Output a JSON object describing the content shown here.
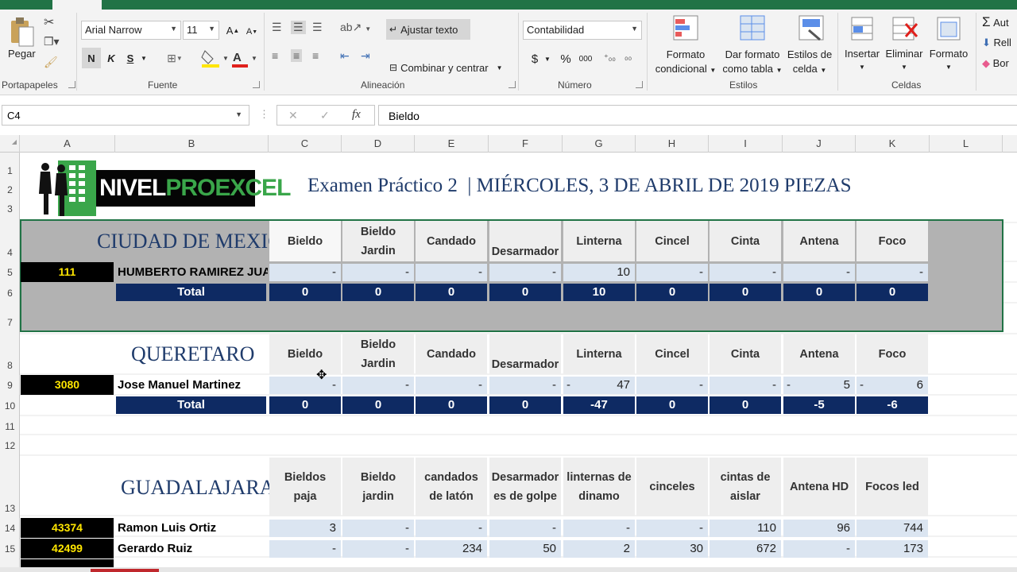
{
  "ribbon": {
    "portapapeles": {
      "pegar": "Pegar",
      "label": "Portapapeles"
    },
    "fuente": {
      "font_name": "Arial Narrow",
      "font_size": "11",
      "bold": "N",
      "italic": "K",
      "underline": "S",
      "label": "Fuente"
    },
    "alineacion": {
      "wrap": "Ajustar texto",
      "merge": "Combinar y centrar",
      "label": "Alineación"
    },
    "numero": {
      "format": "Contabilidad",
      "currency": "$",
      "percent": "%",
      "thousands": "000",
      "label": "Número"
    },
    "estilos": {
      "cond_line1": "Formato",
      "cond_line2": "condicional",
      "table_line1": "Dar formato",
      "table_line2": "como tabla",
      "cell_line1": "Estilos de",
      "cell_line2": "celda",
      "label": "Estilos"
    },
    "celdas": {
      "insertar": "Insertar",
      "eliminar": "Eliminar",
      "formato": "Formato",
      "label": "Celdas"
    },
    "edicion": {
      "auto": "Aut",
      "rell": "Rell",
      "borr": "Bor"
    }
  },
  "formula_bar": {
    "name_box": "C4",
    "cancel": "✕",
    "enter": "✓",
    "fx": "fx",
    "content": "Bieldo"
  },
  "columns": [
    "A",
    "B",
    "C",
    "D",
    "E",
    "F",
    "G",
    "H",
    "I",
    "J",
    "K",
    "L"
  ],
  "rows": [
    "1",
    "2",
    "3",
    "4",
    "5",
    "6",
    "7",
    "8",
    "9",
    "10",
    "11",
    "12",
    "13",
    "14",
    "15"
  ],
  "logo": {
    "text1": "NIVEL",
    "text2": "PRO",
    "text3": "EXCEL"
  },
  "title": "Examen Práctico 2  | MIÉRCOLES, 3 DE ABRIL DE 2019 PIEZAS",
  "cdmx": {
    "city": "CIUDAD DE MEXICO",
    "headers": [
      [
        "Bieldo"
      ],
      [
        "Bieldo",
        "Jardin"
      ],
      [
        "Candado"
      ],
      [
        "Desarmador"
      ],
      [
        "Linterna"
      ],
      [
        "Cincel"
      ],
      [
        "Cinta"
      ],
      [
        "Antena"
      ],
      [
        "Foco"
      ]
    ],
    "id": "111",
    "name": "HUMBERTO RAMIREZ JUAREZ",
    "values": [
      "-",
      "-",
      "-",
      "-",
      "10",
      "-",
      "-",
      "-",
      "-"
    ],
    "total_label": "Total",
    "totals": [
      "0",
      "0",
      "0",
      "0",
      "10",
      "0",
      "0",
      "0",
      "0"
    ]
  },
  "qro": {
    "city": "QUERETARO",
    "headers": [
      [
        "Bieldo"
      ],
      [
        "Bieldo",
        "Jardin"
      ],
      [
        "Candado"
      ],
      [
        "Desarmador"
      ],
      [
        "Linterna"
      ],
      [
        "Cincel"
      ],
      [
        "Cinta"
      ],
      [
        "Antena"
      ],
      [
        "Foco"
      ]
    ],
    "id": "3080",
    "name": "Jose Manuel Martinez",
    "values": [
      "-",
      "-",
      "-",
      "-",
      "47",
      "-",
      "-",
      "5",
      "6"
    ],
    "total_label": "Total",
    "totals": [
      "0",
      "0",
      "0",
      "0",
      "-47",
      "0",
      "0",
      "-5",
      "-6"
    ]
  },
  "gdl": {
    "city": "GUADALAJARA",
    "headers": [
      [
        "Bieldos",
        "paja"
      ],
      [
        "Bieldo",
        "jardin"
      ],
      [
        "candados",
        "de latón"
      ],
      [
        "Desarmador",
        "es de golpe"
      ],
      [
        "linternas de",
        "dinamo"
      ],
      [
        "cinceles"
      ],
      [
        "cintas de",
        "aislar"
      ],
      [
        "Antena HD"
      ],
      [
        "Focos led"
      ]
    ],
    "rows": [
      {
        "id": "43374",
        "name": "Ramon Luis Ortiz",
        "values": [
          "3",
          "-",
          "-",
          "-",
          "-",
          "-",
          "110",
          "96",
          "744"
        ]
      },
      {
        "id": "42499",
        "name": "Gerardo Ruiz",
        "values": [
          "-",
          "-",
          "234",
          "50",
          "2",
          "30",
          "672",
          "-",
          "173"
        ]
      }
    ]
  }
}
